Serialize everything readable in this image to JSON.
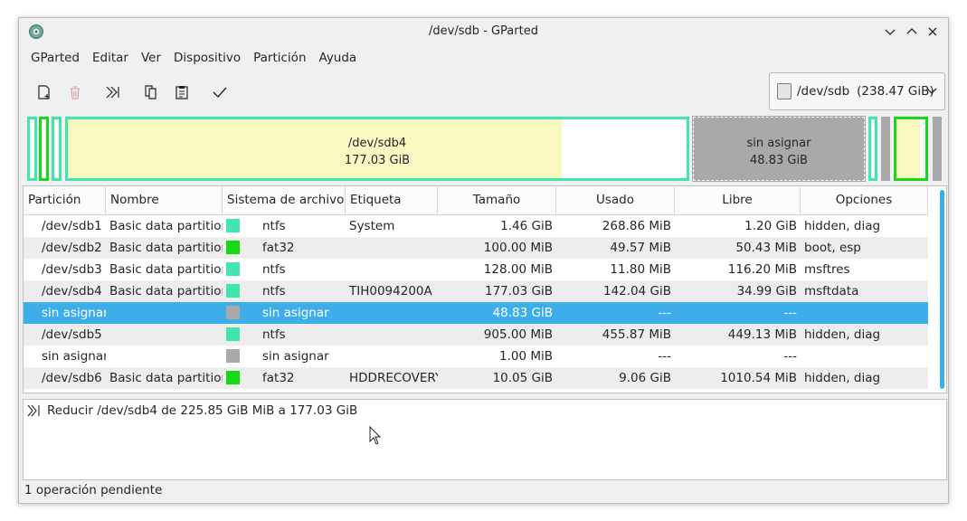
{
  "window": {
    "title": "/dev/sdb - GParted",
    "controls": [
      "minimize-icon",
      "maximize-icon",
      "close-icon"
    ]
  },
  "menu": [
    "GParted",
    "Editar",
    "Ver",
    "Dispositivo",
    "Partición",
    "Ayuda"
  ],
  "toolbar": {
    "icons": [
      "new-partition-icon",
      "delete-icon",
      "resize-move-icon",
      "copy-icon",
      "paste-icon",
      "apply-icon"
    ]
  },
  "device": {
    "label": "/dev/sdb",
    "size": "(238.47 GiB)"
  },
  "map": {
    "big_name": "/dev/sdb4",
    "big_size": "177.03 GiB",
    "big_used_fraction": 0.8,
    "unalloc_name": "sin asignar",
    "unalloc_size": "48.83 GiB"
  },
  "colors": {
    "ntfs": "#42e5ac",
    "fat32": "#18d918",
    "unallocated": "#a9a9a9",
    "used_fill": "#f8f8c0",
    "selection": "#3daee9"
  },
  "table": {
    "headers": [
      "Partición",
      "Nombre",
      "Sistema de archivos",
      "Etiqueta",
      "Tamaño",
      "Usado",
      "Libre",
      "Opciones"
    ],
    "rows": [
      {
        "part": "/dev/sdb1",
        "name": "Basic data partition",
        "fs": "ntfs",
        "label": "System",
        "size": "1.46 GiB",
        "used": "268.86 MiB",
        "free": "1.20 GiB",
        "flags": "hidden, diag"
      },
      {
        "part": "/dev/sdb2",
        "name": "Basic data partition",
        "fs": "fat32",
        "label": "",
        "size": "100.00 MiB",
        "used": "49.57 MiB",
        "free": "50.43 MiB",
        "flags": "boot, esp"
      },
      {
        "part": "/dev/sdb3",
        "name": "Basic data partition",
        "fs": "ntfs",
        "label": "",
        "size": "128.00 MiB",
        "used": "11.80 MiB",
        "free": "116.20 MiB",
        "flags": "msftres"
      },
      {
        "part": "/dev/sdb4",
        "name": "Basic data partition",
        "fs": "ntfs",
        "label": "TIH0094200A",
        "size": "177.03 GiB",
        "used": "142.04 GiB",
        "free": "34.99 GiB",
        "flags": "msftdata"
      },
      {
        "part": "sin asignar",
        "name": "",
        "fs": "sin asignar",
        "label": "",
        "size": "48.83 GiB",
        "used": "---",
        "free": "---",
        "flags": ""
      },
      {
        "part": "/dev/sdb5",
        "name": "",
        "fs": "ntfs",
        "label": "",
        "size": "905.00 MiB",
        "used": "455.87 MiB",
        "free": "449.13 MiB",
        "flags": "hidden, diag"
      },
      {
        "part": "sin asignar",
        "name": "",
        "fs": "sin asignar",
        "label": "",
        "size": "1.00 MiB",
        "used": "---",
        "free": "---",
        "flags": ""
      },
      {
        "part": "/dev/sdb6",
        "name": "Basic data partition",
        "fs": "fat32",
        "label": "HDDRECOVERY",
        "size": "10.05 GiB",
        "used": "9.06 GiB",
        "free": "1010.54 MiB",
        "flags": "hidden, diag"
      }
    ]
  },
  "operations": [
    {
      "icon": "resize-move-icon",
      "text": "Reducir /dev/sdb4 de 225.85 GiB MiB a 177.03 GiB"
    }
  ],
  "status": "1 operación pendiente"
}
